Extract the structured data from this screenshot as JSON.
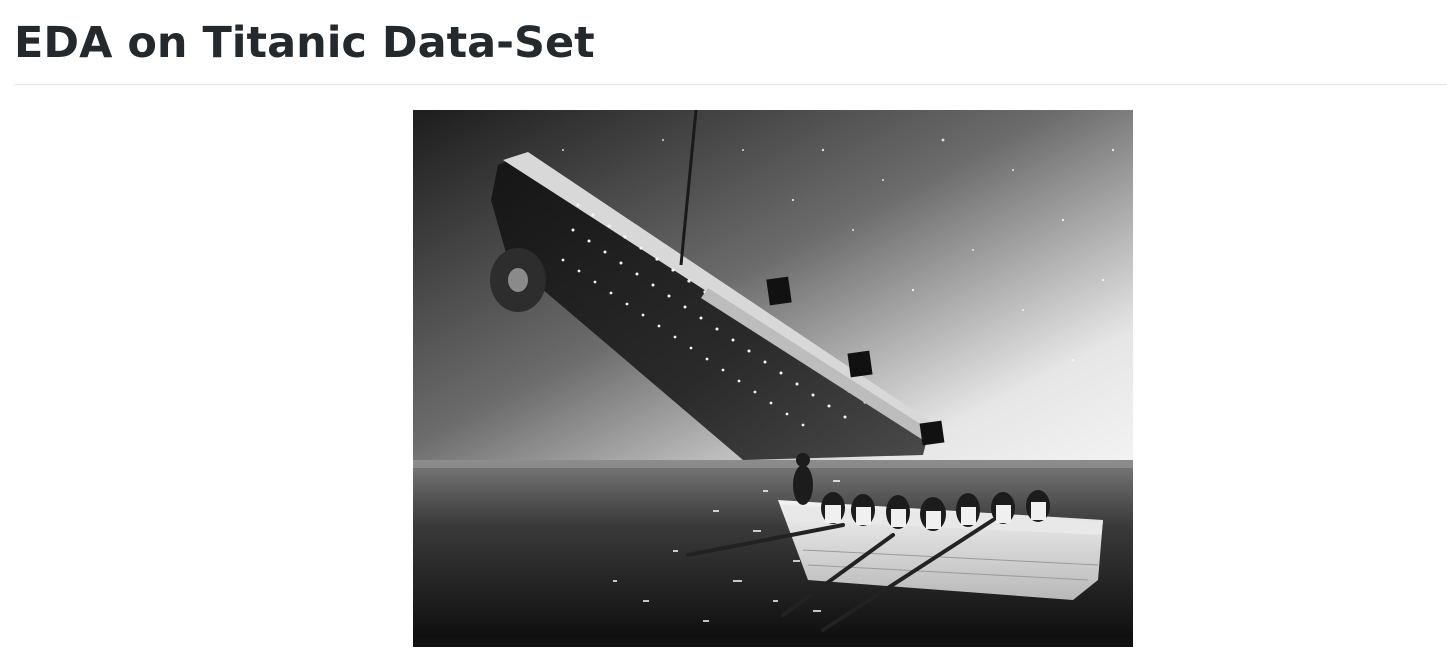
{
  "page": {
    "title": "EDA on Titanic Data-Set"
  },
  "figure": {
    "icon": "titanic-sinking-photo"
  }
}
